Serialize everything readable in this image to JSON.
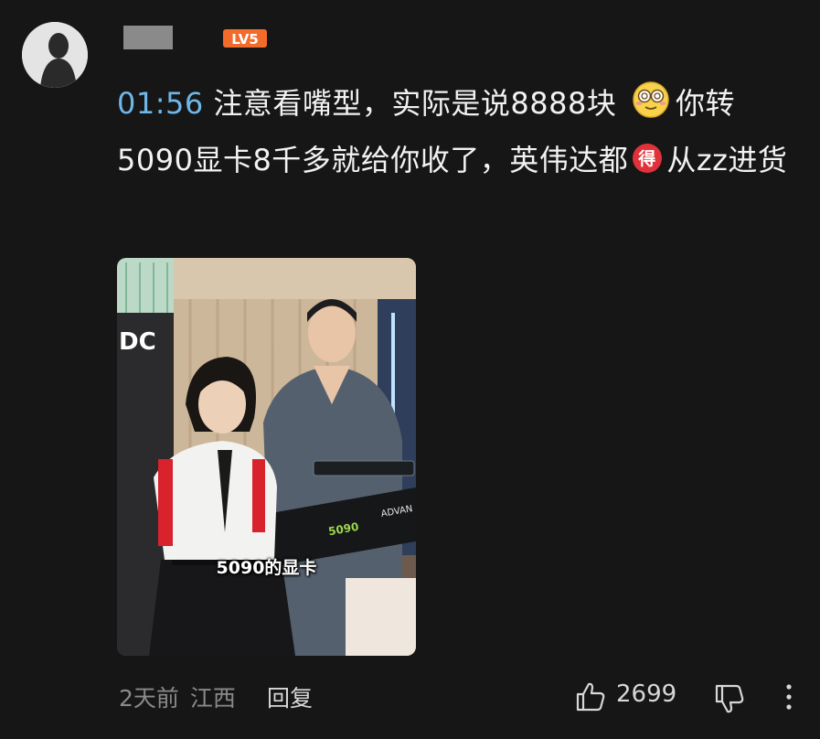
{
  "comment": {
    "user": {
      "avatar_icon": "user-silhouette-icon",
      "level_badge": "LV5",
      "level_color": "#f26b2a"
    },
    "timestamp": "01:56",
    "text_part1": " 注意看嘴型，实际是说8888块",
    "emoji1": "dizzy-face-emoji",
    "text_part2": "你转5090显卡8千多就给你收了，英伟达都",
    "emoji2": "de-sticker-emoji",
    "emoji2_char": "得",
    "text_part3": "从zz进货",
    "video": {
      "caption": "5090的显卡"
    },
    "footer": {
      "time": "2天前",
      "location": "江西",
      "reply_label": "回复",
      "like_count": "2699"
    }
  },
  "colors": {
    "background": "#161616",
    "timestamp": "#6fb7e8",
    "text": "#f2f2f2",
    "muted": "#8a8a8a"
  }
}
